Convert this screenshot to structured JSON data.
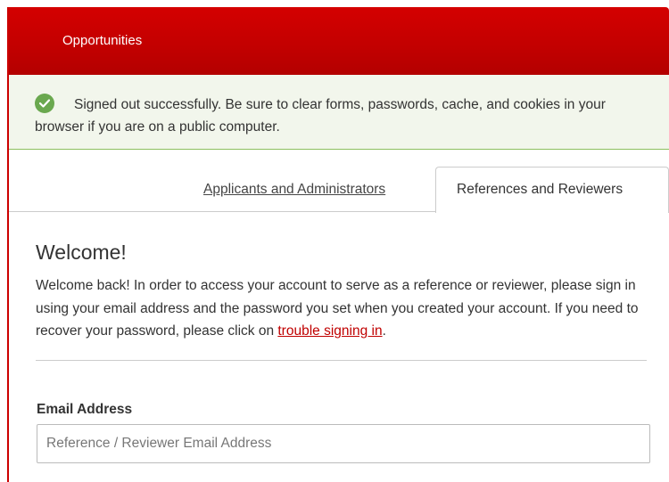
{
  "header": {
    "nav_item": "Opportunities"
  },
  "alert": {
    "icon": "check-circle-icon",
    "message": "Signed out successfully. Be sure to clear forms, passwords, cache, and cookies in your browser if you are on a public computer."
  },
  "tabs": [
    {
      "label": "Applicants and Administrators",
      "active": false
    },
    {
      "label": "References and Reviewers",
      "active": true
    }
  ],
  "welcome": {
    "title": "Welcome!",
    "body": "Welcome back! In order to access your account to serve as a reference or reviewer, please sign in using your email address and the password you set when you created your account. If you need to recover your password, please click on ",
    "link": "trouble signing in",
    "tail": "."
  },
  "form": {
    "email_label": "Email Address",
    "email_placeholder": "Reference / Reviewer Email Address",
    "email_value": ""
  },
  "colors": {
    "brand_red": "#cc0000",
    "success_green": "#6aa84f",
    "alert_background": "#f2f6ec"
  }
}
